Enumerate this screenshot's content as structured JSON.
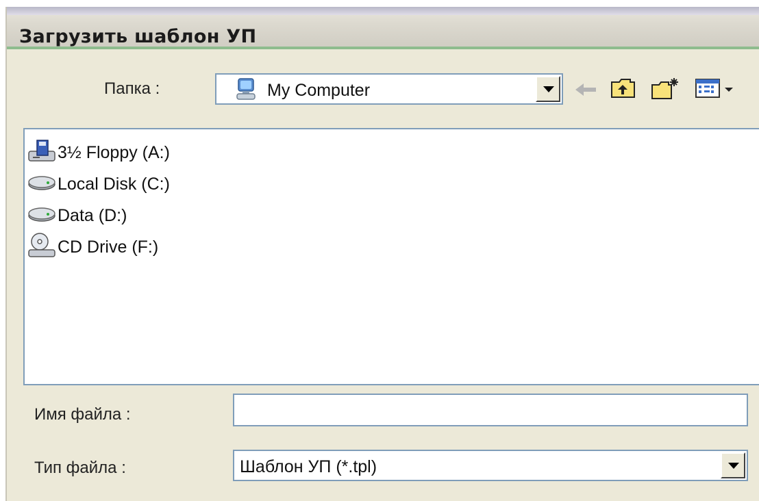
{
  "window": {
    "title": "Загрузить шаблон УП"
  },
  "toolbar": {
    "folder_label": "Папка :",
    "folder_value": "My Computer",
    "folder_icon": "my-computer-icon",
    "buttons": [
      "back-arrow-icon",
      "up-one-level-icon",
      "new-folder-icon",
      "view-menu-icon"
    ]
  },
  "file_list": {
    "items": [
      {
        "label": "3½ Floppy (A:)",
        "icon": "floppy-drive-icon"
      },
      {
        "label": "Local Disk (C:)",
        "icon": "hard-disk-icon"
      },
      {
        "label": "Data (D:)",
        "icon": "hard-disk-icon"
      },
      {
        "label": "CD Drive (F:)",
        "icon": "cd-drive-icon"
      }
    ]
  },
  "filename": {
    "label": "Имя файла :",
    "value": ""
  },
  "filetype": {
    "label": "Тип файла :",
    "value": "Шаблон УП (*.tpl)"
  },
  "colors": {
    "accent_line": "#8ebc8e",
    "field_border": "#7f9db9",
    "dialog_bg": "#ece9d8"
  }
}
